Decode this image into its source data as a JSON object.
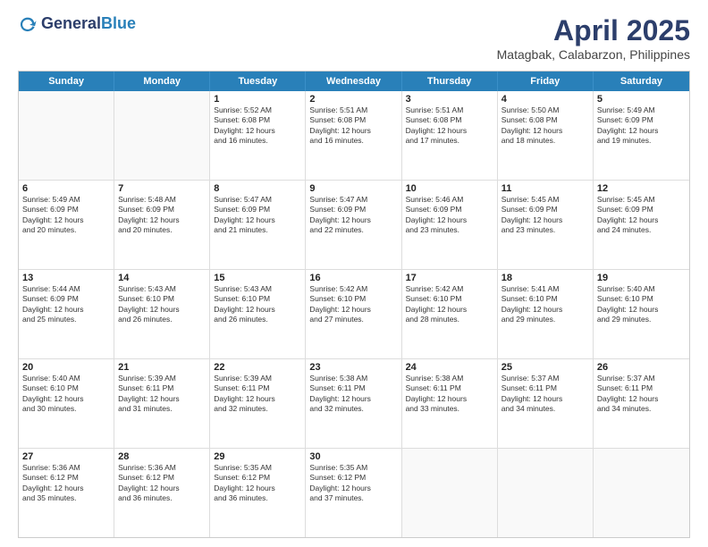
{
  "logo": {
    "general": "General",
    "blue": "Blue"
  },
  "header": {
    "title": "April 2025",
    "subtitle": "Matagbak, Calabarzon, Philippines"
  },
  "days": [
    "Sunday",
    "Monday",
    "Tuesday",
    "Wednesday",
    "Thursday",
    "Friday",
    "Saturday"
  ],
  "weeks": [
    [
      {
        "day": "",
        "lines": []
      },
      {
        "day": "",
        "lines": []
      },
      {
        "day": "1",
        "lines": [
          "Sunrise: 5:52 AM",
          "Sunset: 6:08 PM",
          "Daylight: 12 hours",
          "and 16 minutes."
        ]
      },
      {
        "day": "2",
        "lines": [
          "Sunrise: 5:51 AM",
          "Sunset: 6:08 PM",
          "Daylight: 12 hours",
          "and 16 minutes."
        ]
      },
      {
        "day": "3",
        "lines": [
          "Sunrise: 5:51 AM",
          "Sunset: 6:08 PM",
          "Daylight: 12 hours",
          "and 17 minutes."
        ]
      },
      {
        "day": "4",
        "lines": [
          "Sunrise: 5:50 AM",
          "Sunset: 6:08 PM",
          "Daylight: 12 hours",
          "and 18 minutes."
        ]
      },
      {
        "day": "5",
        "lines": [
          "Sunrise: 5:49 AM",
          "Sunset: 6:09 PM",
          "Daylight: 12 hours",
          "and 19 minutes."
        ]
      }
    ],
    [
      {
        "day": "6",
        "lines": [
          "Sunrise: 5:49 AM",
          "Sunset: 6:09 PM",
          "Daylight: 12 hours",
          "and 20 minutes."
        ]
      },
      {
        "day": "7",
        "lines": [
          "Sunrise: 5:48 AM",
          "Sunset: 6:09 PM",
          "Daylight: 12 hours",
          "and 20 minutes."
        ]
      },
      {
        "day": "8",
        "lines": [
          "Sunrise: 5:47 AM",
          "Sunset: 6:09 PM",
          "Daylight: 12 hours",
          "and 21 minutes."
        ]
      },
      {
        "day": "9",
        "lines": [
          "Sunrise: 5:47 AM",
          "Sunset: 6:09 PM",
          "Daylight: 12 hours",
          "and 22 minutes."
        ]
      },
      {
        "day": "10",
        "lines": [
          "Sunrise: 5:46 AM",
          "Sunset: 6:09 PM",
          "Daylight: 12 hours",
          "and 23 minutes."
        ]
      },
      {
        "day": "11",
        "lines": [
          "Sunrise: 5:45 AM",
          "Sunset: 6:09 PM",
          "Daylight: 12 hours",
          "and 23 minutes."
        ]
      },
      {
        "day": "12",
        "lines": [
          "Sunrise: 5:45 AM",
          "Sunset: 6:09 PM",
          "Daylight: 12 hours",
          "and 24 minutes."
        ]
      }
    ],
    [
      {
        "day": "13",
        "lines": [
          "Sunrise: 5:44 AM",
          "Sunset: 6:09 PM",
          "Daylight: 12 hours",
          "and 25 minutes."
        ]
      },
      {
        "day": "14",
        "lines": [
          "Sunrise: 5:43 AM",
          "Sunset: 6:10 PM",
          "Daylight: 12 hours",
          "and 26 minutes."
        ]
      },
      {
        "day": "15",
        "lines": [
          "Sunrise: 5:43 AM",
          "Sunset: 6:10 PM",
          "Daylight: 12 hours",
          "and 26 minutes."
        ]
      },
      {
        "day": "16",
        "lines": [
          "Sunrise: 5:42 AM",
          "Sunset: 6:10 PM",
          "Daylight: 12 hours",
          "and 27 minutes."
        ]
      },
      {
        "day": "17",
        "lines": [
          "Sunrise: 5:42 AM",
          "Sunset: 6:10 PM",
          "Daylight: 12 hours",
          "and 28 minutes."
        ]
      },
      {
        "day": "18",
        "lines": [
          "Sunrise: 5:41 AM",
          "Sunset: 6:10 PM",
          "Daylight: 12 hours",
          "and 29 minutes."
        ]
      },
      {
        "day": "19",
        "lines": [
          "Sunrise: 5:40 AM",
          "Sunset: 6:10 PM",
          "Daylight: 12 hours",
          "and 29 minutes."
        ]
      }
    ],
    [
      {
        "day": "20",
        "lines": [
          "Sunrise: 5:40 AM",
          "Sunset: 6:10 PM",
          "Daylight: 12 hours",
          "and 30 minutes."
        ]
      },
      {
        "day": "21",
        "lines": [
          "Sunrise: 5:39 AM",
          "Sunset: 6:11 PM",
          "Daylight: 12 hours",
          "and 31 minutes."
        ]
      },
      {
        "day": "22",
        "lines": [
          "Sunrise: 5:39 AM",
          "Sunset: 6:11 PM",
          "Daylight: 12 hours",
          "and 32 minutes."
        ]
      },
      {
        "day": "23",
        "lines": [
          "Sunrise: 5:38 AM",
          "Sunset: 6:11 PM",
          "Daylight: 12 hours",
          "and 32 minutes."
        ]
      },
      {
        "day": "24",
        "lines": [
          "Sunrise: 5:38 AM",
          "Sunset: 6:11 PM",
          "Daylight: 12 hours",
          "and 33 minutes."
        ]
      },
      {
        "day": "25",
        "lines": [
          "Sunrise: 5:37 AM",
          "Sunset: 6:11 PM",
          "Daylight: 12 hours",
          "and 34 minutes."
        ]
      },
      {
        "day": "26",
        "lines": [
          "Sunrise: 5:37 AM",
          "Sunset: 6:11 PM",
          "Daylight: 12 hours",
          "and 34 minutes."
        ]
      }
    ],
    [
      {
        "day": "27",
        "lines": [
          "Sunrise: 5:36 AM",
          "Sunset: 6:12 PM",
          "Daylight: 12 hours",
          "and 35 minutes."
        ]
      },
      {
        "day": "28",
        "lines": [
          "Sunrise: 5:36 AM",
          "Sunset: 6:12 PM",
          "Daylight: 12 hours",
          "and 36 minutes."
        ]
      },
      {
        "day": "29",
        "lines": [
          "Sunrise: 5:35 AM",
          "Sunset: 6:12 PM",
          "Daylight: 12 hours",
          "and 36 minutes."
        ]
      },
      {
        "day": "30",
        "lines": [
          "Sunrise: 5:35 AM",
          "Sunset: 6:12 PM",
          "Daylight: 12 hours",
          "and 37 minutes."
        ]
      },
      {
        "day": "",
        "lines": []
      },
      {
        "day": "",
        "lines": []
      },
      {
        "day": "",
        "lines": []
      }
    ]
  ]
}
